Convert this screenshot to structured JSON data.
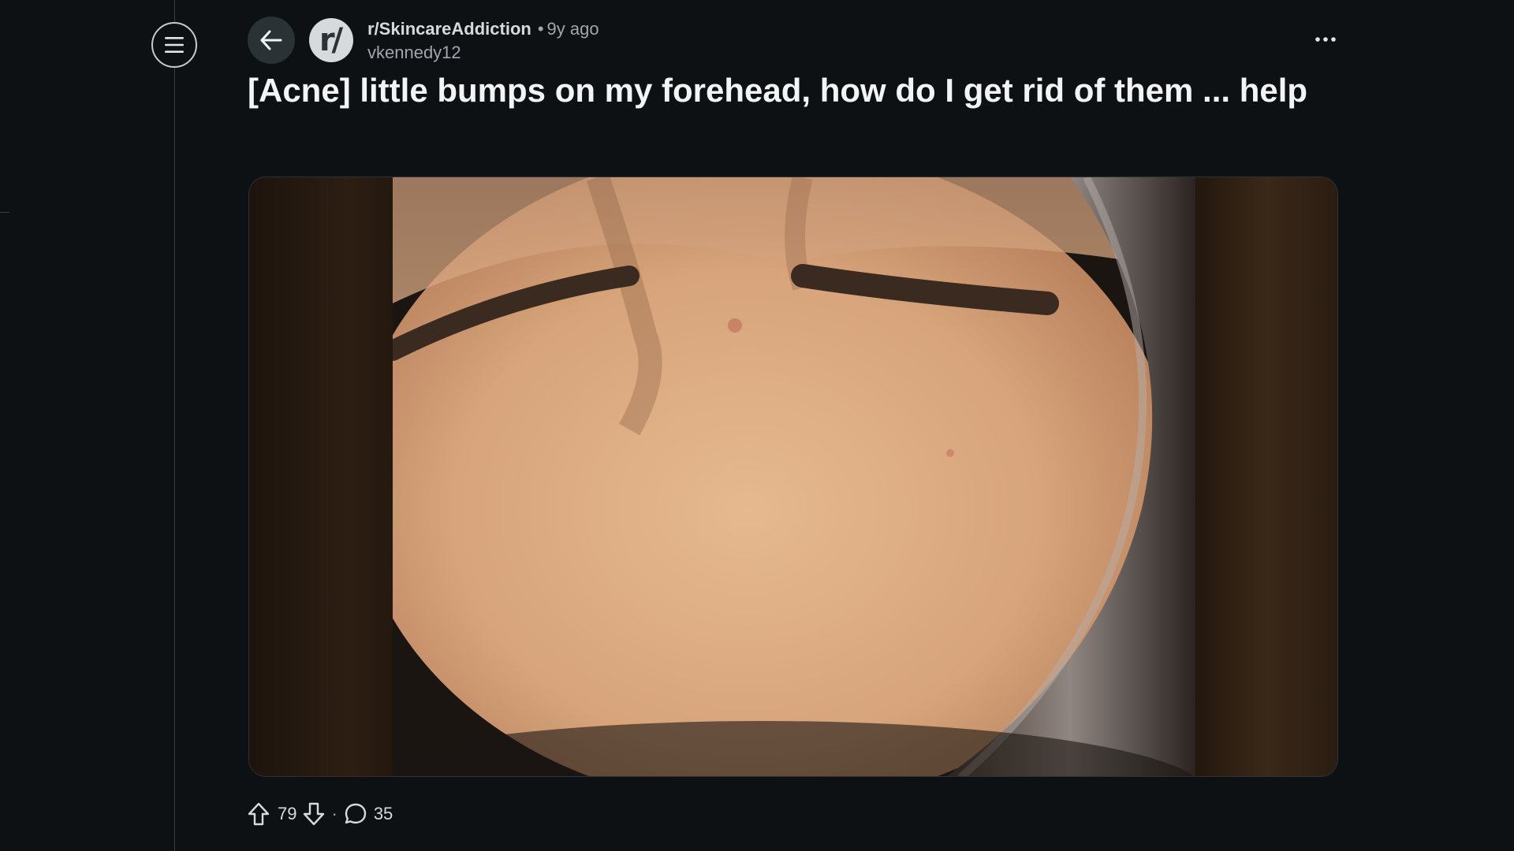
{
  "header": {
    "subreddit": "r/SkincareAddiction",
    "separator": "•",
    "timestamp": "9y ago",
    "author": "vkennedy12",
    "avatar_text": "r/"
  },
  "post": {
    "title": "[Acne] little bumps on my forehead, how do I get rid of them ... help"
  },
  "actions": {
    "upvotes": "79",
    "separator": "·",
    "comments": "35"
  },
  "icons": {
    "menu": "hamburger-menu-icon",
    "back": "arrow-left-icon",
    "more": "ellipsis-horizontal-icon",
    "upvote": "arrow-up-outline-icon",
    "downvote": "arrow-down-outline-icon",
    "comment": "speech-bubble-icon"
  },
  "colors": {
    "background": "#0e1113",
    "button_bg": "#2a3236",
    "text_primary": "#f2f4f5",
    "text_secondary": "#a0a7ab"
  }
}
